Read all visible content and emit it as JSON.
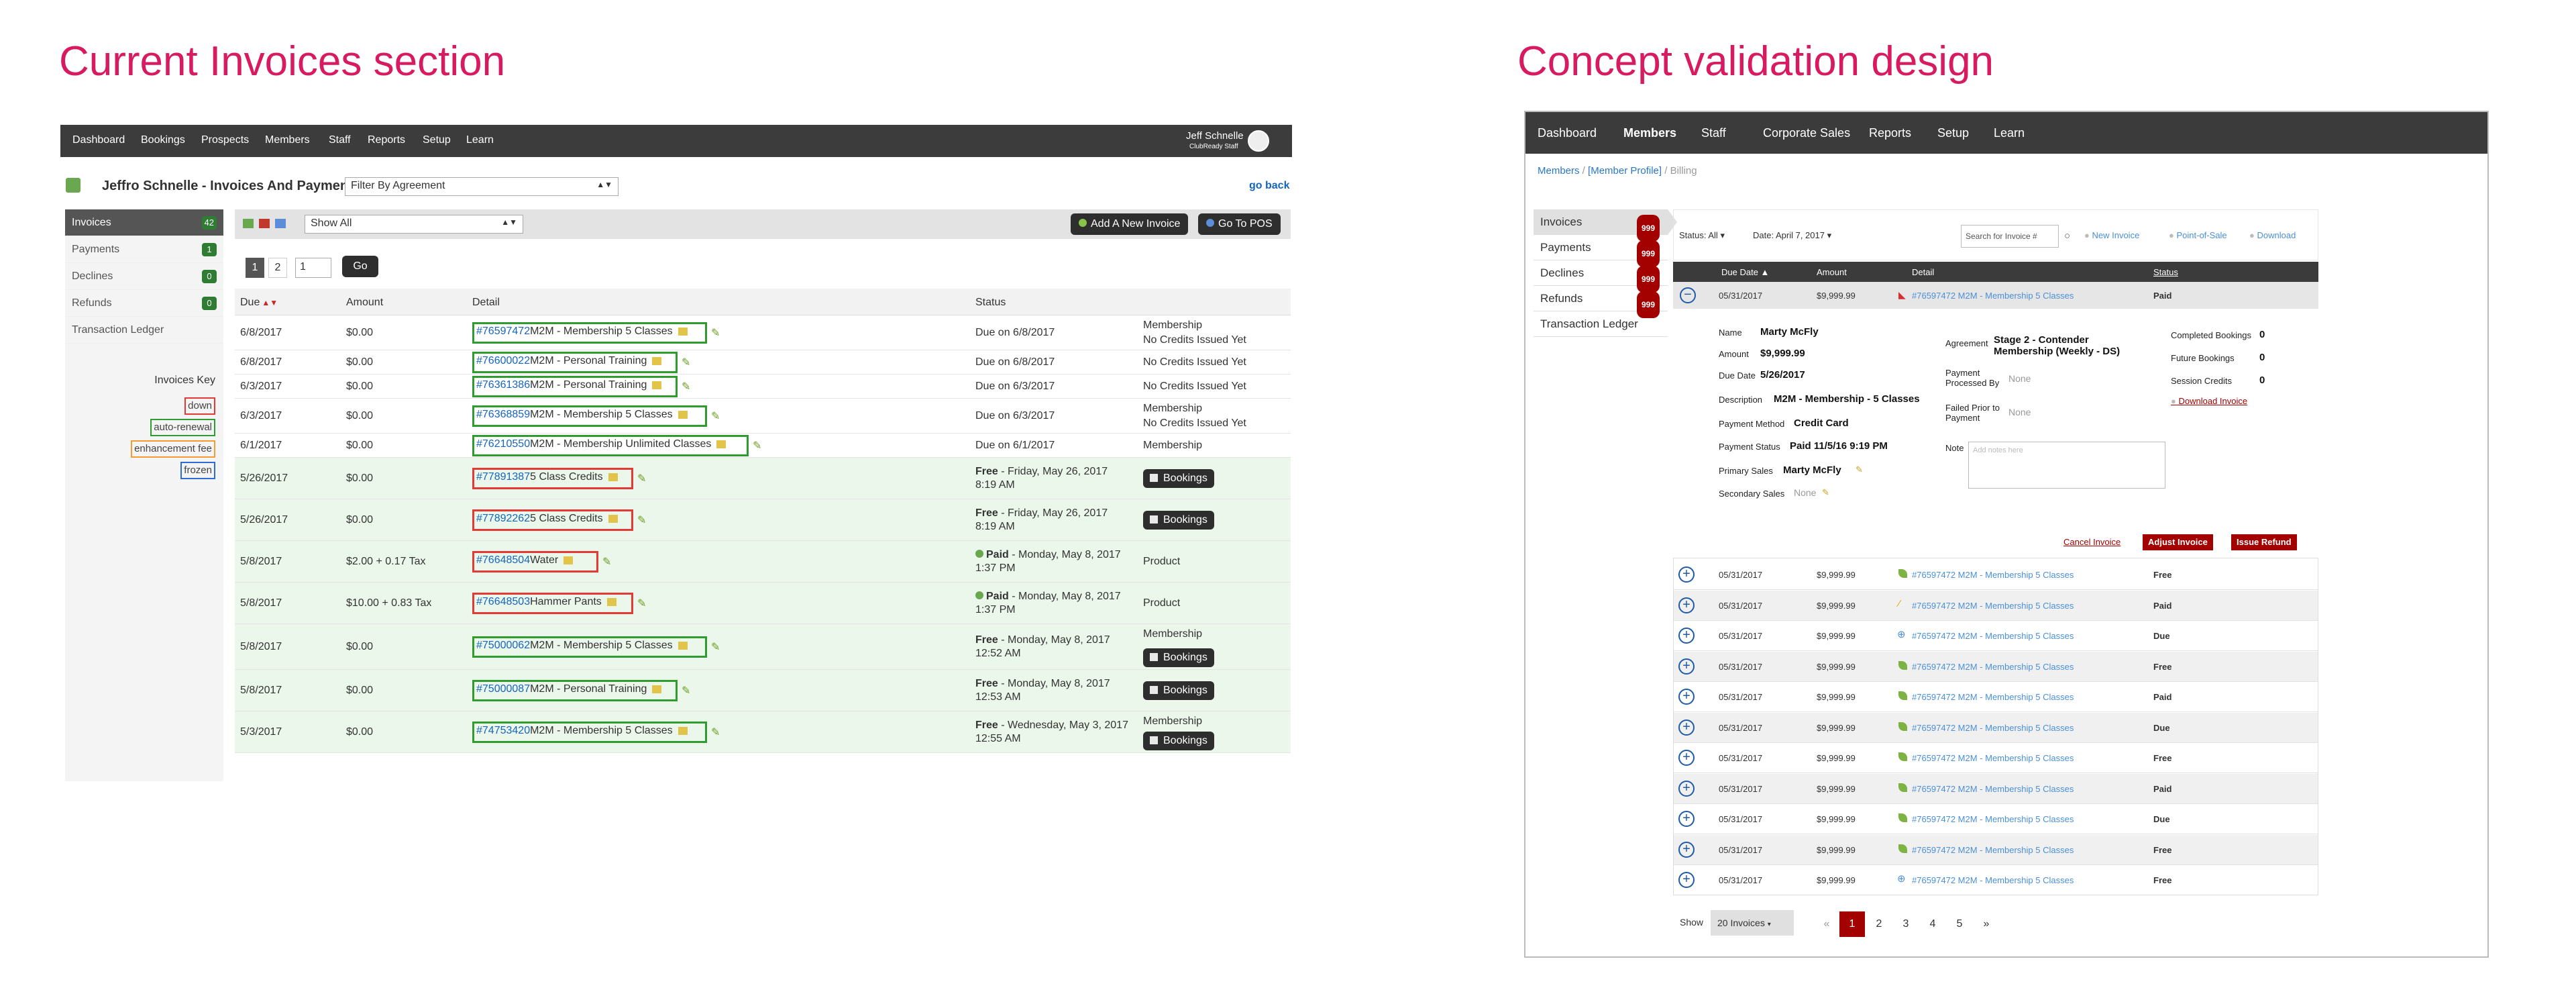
{
  "titles": {
    "current": "Current Invoices section",
    "concept": "Concept validation design"
  },
  "current": {
    "nav": [
      "Dashboard",
      "Bookings",
      "Prospects",
      "Members",
      "Staff",
      "Reports",
      "Setup",
      "Learn"
    ],
    "user": {
      "name": "Jeff Schnelle",
      "role": "ClubReady Staff"
    },
    "page_title": "Jeffro Schnelle - Invoices And Payments",
    "filter_select": "Filter By Agreement",
    "go_back": "go back",
    "sidebar": [
      {
        "label": "Invoices",
        "count": "42"
      },
      {
        "label": "Payments",
        "count": "1"
      },
      {
        "label": "Declines",
        "count": "0"
      },
      {
        "label": "Refunds",
        "count": "0"
      },
      {
        "label": "Transaction Ledger",
        "count": ""
      }
    ],
    "key": {
      "title": "Invoices Key",
      "items": [
        "down",
        "auto-renewal",
        "enhancement fee",
        "frozen"
      ]
    },
    "toolbar": {
      "show_select": "Show All",
      "add_invoice": "Add A New Invoice",
      "go_to_pos": "Go To POS"
    },
    "pager": {
      "pages": [
        "1",
        "2"
      ],
      "input": "1",
      "go": "Go"
    },
    "columns": [
      "Due",
      "Amount",
      "Detail",
      "Status"
    ],
    "rows": [
      {
        "due": "6/8/2017",
        "amount": "$0.00",
        "num": "#76597472",
        "desc": "M2M - Membership 5 Classes",
        "status": "Due on 6/8/2017",
        "status_bold": "",
        "extra1": "Membership",
        "extra2": "No Credits Issued Yet",
        "bookings": false
      },
      {
        "due": "6/8/2017",
        "amount": "$0.00",
        "num": "#76600022",
        "desc": "M2M - Personal Training",
        "status": "Due on 6/8/2017",
        "status_bold": "",
        "extra1": "No Credits Issued Yet",
        "extra2": "",
        "bookings": false
      },
      {
        "due": "6/3/2017",
        "amount": "$0.00",
        "num": "#76361386",
        "desc": "M2M - Personal Training",
        "status": "Due on 6/3/2017",
        "status_bold": "",
        "extra1": "No Credits Issued Yet",
        "extra2": "",
        "bookings": false
      },
      {
        "due": "6/3/2017",
        "amount": "$0.00",
        "num": "#76368859",
        "desc": "M2M - Membership 5 Classes",
        "status": "Due on 6/3/2017",
        "status_bold": "",
        "extra1": "Membership",
        "extra2": "No Credits Issued Yet",
        "bookings": false
      },
      {
        "due": "6/1/2017",
        "amount": "$0.00",
        "num": "#76210550",
        "desc": "M2M - Membership Unlimited Classes",
        "status": "Due on 6/1/2017",
        "status_bold": "",
        "extra1": "Membership",
        "extra2": "",
        "bookings": false
      },
      {
        "due": "5/26/2017",
        "amount": "$0.00",
        "num": "#77891387",
        "desc": "5 Class Credits",
        "status_bold": "Free",
        "status": " - Friday, May 26, 2017",
        "status2": "8:19 AM",
        "extra1": "",
        "extra2": "",
        "bookings": true
      },
      {
        "due": "5/26/2017",
        "amount": "$0.00",
        "num": "#77892262",
        "desc": "5 Class Credits",
        "status_bold": "Free",
        "status": " - Friday, May 26, 2017",
        "status2": "8:19 AM",
        "extra1": "",
        "extra2": "",
        "bookings": true
      },
      {
        "due": "5/8/2017",
        "amount": "$2.00 + 0.17 Tax",
        "num": "#76648504",
        "desc": "Water",
        "status_bold": "Paid",
        "status": " - Monday, May 8, 2017",
        "status2": "1:37 PM",
        "extra1": "Product",
        "extra2": "",
        "bookings": false
      },
      {
        "due": "5/8/2017",
        "amount": "$10.00 + 0.83 Tax",
        "num": "#76648503",
        "desc": "Hammer Pants",
        "status_bold": "Paid",
        "status": " - Monday, May 8, 2017",
        "status2": "1:37 PM",
        "extra1": "Product",
        "extra2": "",
        "bookings": false
      },
      {
        "due": "5/8/2017",
        "amount": "$0.00",
        "num": "#75000062",
        "desc": "M2M - Membership 5 Classes",
        "status_bold": "Free",
        "status": " - Monday, May 8, 2017",
        "status2": "12:52 AM",
        "extra1": "Membership",
        "extra2": "",
        "bookings": true
      },
      {
        "due": "5/8/2017",
        "amount": "$0.00",
        "num": "#75000087",
        "desc": "M2M - Personal Training",
        "status_bold": "Free",
        "status": " - Monday, May 8, 2017",
        "status2": "12:53 AM",
        "extra1": "",
        "extra2": "",
        "bookings": true
      },
      {
        "due": "5/3/2017",
        "amount": "$0.00",
        "num": "#74753420",
        "desc": "M2M - Membership 5 Classes",
        "status_bold": "Free",
        "status": " - Wednesday, May 3, 2017",
        "status2": "12:55 AM",
        "extra1": "Membership",
        "extra2": "",
        "bookings": true
      }
    ],
    "bookings_label": "Bookings"
  },
  "concept": {
    "nav": [
      "Dashboard",
      "Members",
      "Staff",
      "Corporate Sales",
      "Reports",
      "Setup",
      "Learn"
    ],
    "breadcrumb": {
      "a": "Members",
      "sep1": " / ",
      "b": "[Member Profile]",
      "sep2": " / ",
      "c": "Billing"
    },
    "sidebar": [
      {
        "label": "Invoices",
        "count": "999"
      },
      {
        "label": "Payments",
        "count": "999"
      },
      {
        "label": "Declines",
        "count": "999"
      },
      {
        "label": "Refunds",
        "count": "999"
      },
      {
        "label": "Transaction Ledger",
        "count": ""
      }
    ],
    "filters": {
      "status": "Status: All",
      "date": "Date: April 7, 2017",
      "search_placeholder": "Search for Invoice #",
      "new_invoice": "New Invoice",
      "pos": "Point-of-Sale",
      "download": "Download"
    },
    "columns": [
      "Due Date",
      "Amount",
      "Detail",
      "Status"
    ],
    "expanded": {
      "date": "05/31/2017",
      "amount": "$9,999.99",
      "detail": "#76597472 M2M - Membership 5 Classes",
      "status": "Paid",
      "labels": {
        "name": "Name",
        "amount": "Amount",
        "due": "Due Date",
        "desc": "Description",
        "method": "Payment Method",
        "pstatus": "Payment Status",
        "primary": "Primary Sales",
        "secondary": "Secondary Sales",
        "agreement": "Agreement",
        "processed": "Payment Processed By",
        "failed": "Failed Prior to Payment",
        "note": "Note",
        "completed": "Completed Bookings",
        "future": "Future Bookings",
        "session": "Session Credits",
        "download": "Download Invoice"
      },
      "values": {
        "name": "Marty McFly",
        "amount": "$9,999.99",
        "due": "5/26/2017",
        "desc": "M2M - Membership - 5 Classes",
        "method": "Credit Card",
        "pstatus": "Paid 11/5/16 9:19 PM",
        "primary": "Marty McFly",
        "secondary": "None",
        "agreement": "Stage 2 - Contender Membership (Weekly - DS)",
        "processed": "None",
        "failed": "None",
        "note_placeholder": "Add notes here",
        "completed": "0",
        "future": "0",
        "session": "0"
      },
      "actions": {
        "cancel": "Cancel Invoice",
        "adjust": "Adjust Invoice",
        "refund": "Issue Refund"
      }
    },
    "rows": [
      {
        "date": "05/31/2017",
        "amount": "$9,999.99",
        "detail": "#76597472 M2M - Membership 5 Classes",
        "status": "Free",
        "icon": "leaf"
      },
      {
        "date": "05/31/2017",
        "amount": "$9,999.99",
        "detail": "#76597472 M2M - Membership 5 Classes",
        "status": "Paid",
        "icon": "wand"
      },
      {
        "date": "05/31/2017",
        "amount": "$9,999.99",
        "detail": "#76597472 M2M - Membership 5 Classes",
        "status": "Due",
        "icon": "target"
      },
      {
        "date": "05/31/2017",
        "amount": "$9,999.99",
        "detail": "#76597472 M2M - Membership 5 Classes",
        "status": "Free",
        "icon": "leaf"
      },
      {
        "date": "05/31/2017",
        "amount": "$9,999.99",
        "detail": "#76597472 M2M - Membership 5 Classes",
        "status": "Paid",
        "icon": "leaf"
      },
      {
        "date": "05/31/2017",
        "amount": "$9,999.99",
        "detail": "#76597472 M2M - Membership 5 Classes",
        "status": "Due",
        "icon": "leaf"
      },
      {
        "date": "05/31/2017",
        "amount": "$9,999.99",
        "detail": "#76597472 M2M - Membership 5 Classes",
        "status": "Free",
        "icon": "leaf"
      },
      {
        "date": "05/31/2017",
        "amount": "$9,999.99",
        "detail": "#76597472 M2M - Membership 5 Classes",
        "status": "Paid",
        "icon": "leaf"
      },
      {
        "date": "05/31/2017",
        "amount": "$9,999.99",
        "detail": "#76597472 M2M - Membership 5 Classes",
        "status": "Due",
        "icon": "leaf"
      },
      {
        "date": "05/31/2017",
        "amount": "$9,999.99",
        "detail": "#76597472 M2M - Membership 5 Classes",
        "status": "Free",
        "icon": "leaf"
      },
      {
        "date": "05/31/2017",
        "amount": "$9,999.99",
        "detail": "#76597472 M2M - Membership 5 Classes",
        "status": "Free",
        "icon": "target"
      }
    ],
    "footer": {
      "show": "Show",
      "per_page": "20 Invoices",
      "prev": "«",
      "pages": [
        "1",
        "2",
        "3",
        "4",
        "5"
      ],
      "next": "»"
    }
  }
}
